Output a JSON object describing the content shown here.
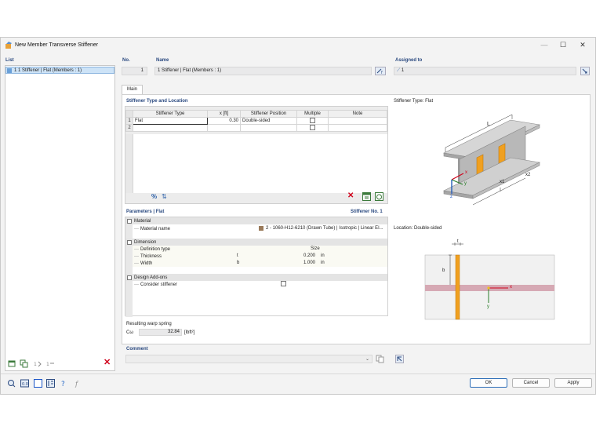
{
  "window": {
    "title": "New Member Transverse Stiffener",
    "minimize": "—",
    "maximize": "☐",
    "close": "✕"
  },
  "list": {
    "label": "List",
    "items": [
      "1  1 Stiffener | Flat (Members : 1)"
    ]
  },
  "no": {
    "label": "No.",
    "value": "1"
  },
  "name": {
    "label": "Name",
    "value": "1 Stiffener | Flat (Members : 1)"
  },
  "assigned": {
    "label": "Assigned to",
    "value": "1"
  },
  "tabs": [
    "Main"
  ],
  "type_location": {
    "title": "Stiffener Type and Location",
    "columns": [
      "Stiffener Type",
      "x [ft]",
      "Stiffener Position",
      "Multiple",
      "Note"
    ],
    "rows": [
      {
        "num": "1",
        "type": "Flat",
        "x": "0.30",
        "position": "Double-sided",
        "multiple": false,
        "note": ""
      },
      {
        "num": "2",
        "type": "",
        "x": "",
        "position": "",
        "multiple": false,
        "note": ""
      }
    ]
  },
  "parameters": {
    "title": "Parameters | Flat",
    "right_title": "Stiffener No. 1",
    "material_group": "Material",
    "material_name_label": "Material name",
    "material_name_value": "2 - 1060-H12-6210 (Drawn Tube) | Isotropic | Linear El...",
    "dimension_group": "Dimension",
    "definition_type_label": "Definition type",
    "definition_type_value": "Size",
    "thickness_label": "Thickness",
    "thickness_sym": "t",
    "thickness_value": "0.200",
    "thickness_unit": "in",
    "width_label": "Width",
    "width_sym": "b",
    "width_value": "1.000",
    "width_unit": "in",
    "addons_group": "Design Add-ons",
    "consider_label": "Consider stiffener"
  },
  "warp": {
    "label": "Resulting warp spring",
    "sym": "Cω",
    "value": "32.84",
    "unit": "[lbft²]"
  },
  "comment": {
    "label": "Comment",
    "value": ""
  },
  "figure": {
    "type_caption": "Stiffener Type: Flat",
    "location_caption": "Location: Double-sided",
    "dim_L": "L",
    "dim_x1": "x1",
    "dim_x2": "x2",
    "axis_x": "x",
    "axis_y": "y",
    "axis_z": "z",
    "dim_t": "t",
    "dim_b": "b"
  },
  "buttons": {
    "ok": "OK",
    "cancel": "Cancel",
    "apply": "Apply"
  },
  "colors": {
    "accent": "#2b4a80",
    "stiffener": "#f0a020",
    "selected": "#cde3f7"
  }
}
